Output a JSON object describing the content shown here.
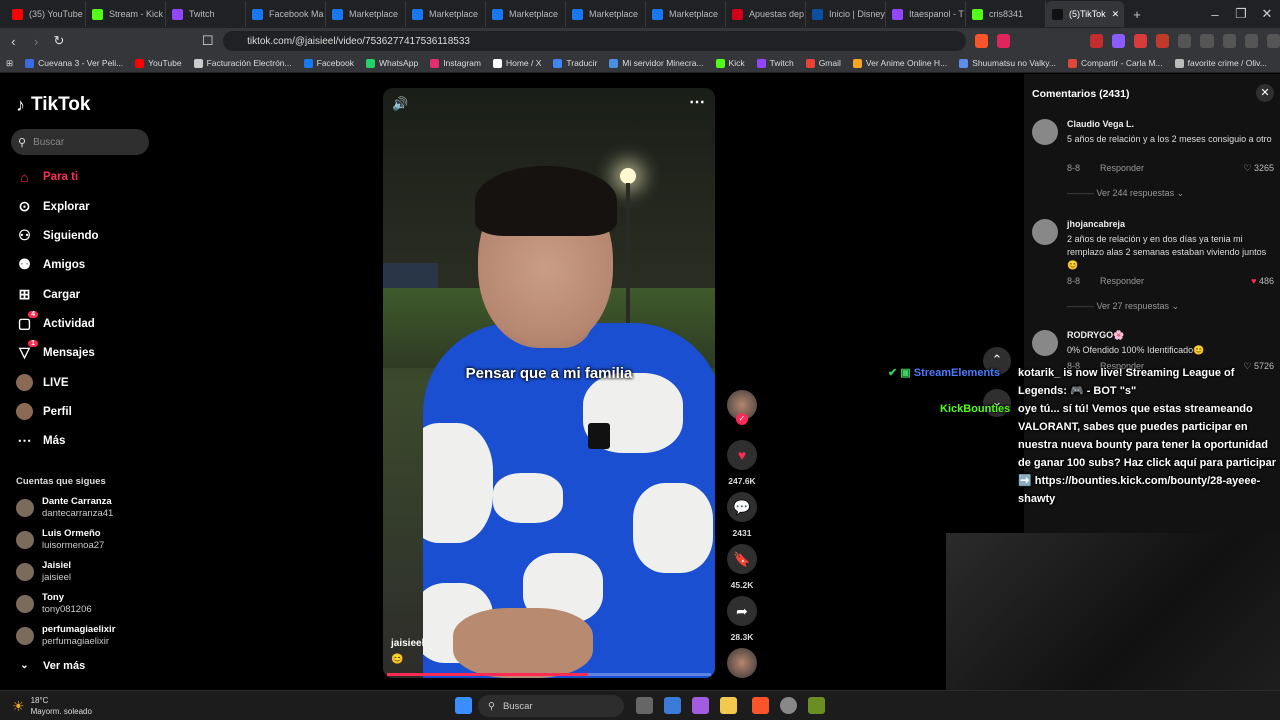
{
  "browser": {
    "tabs": [
      {
        "label": "(35) YouTube",
        "color": "#ff0000"
      },
      {
        "label": "Stream - Kick",
        "color": "#53fc18"
      },
      {
        "label": "Twitch",
        "color": "#9146ff"
      },
      {
        "label": "Facebook Ma",
        "color": "#1877f2"
      },
      {
        "label": "Marketplace",
        "color": "#1877f2"
      },
      {
        "label": "Marketplace",
        "color": "#1877f2"
      },
      {
        "label": "Marketplace",
        "color": "#1877f2"
      },
      {
        "label": "Marketplace",
        "color": "#1877f2"
      },
      {
        "label": "Marketplace",
        "color": "#1877f2"
      },
      {
        "label": "Apuestas dep",
        "color": "#d4001a"
      },
      {
        "label": "Inicio | Disney",
        "color": "#0b4ea2"
      },
      {
        "label": "Itaespanol - T",
        "color": "#9146ff"
      },
      {
        "label": "cris8341",
        "color": "#53fc18"
      },
      {
        "label": "(5)TikTok",
        "color": "#111111",
        "active": true
      }
    ],
    "url": "tiktok.com/@jaisieel/video/7536277417536118533",
    "bookmarks": [
      {
        "label": "Cuevana 3 - Ver Peli...",
        "color": "#3a6be0"
      },
      {
        "label": "YouTube",
        "color": "#ff0000"
      },
      {
        "label": "Facturación Electrón...",
        "color": "#cccccc"
      },
      {
        "label": "Facebook",
        "color": "#1877f2"
      },
      {
        "label": "WhatsApp",
        "color": "#25d366"
      },
      {
        "label": "Instagram",
        "color": "#e1306c"
      },
      {
        "label": "Home / X",
        "color": "#ffffff"
      },
      {
        "label": "Traducir",
        "color": "#4285f4"
      },
      {
        "label": "Mi servidor Minecra...",
        "color": "#4a90e2"
      },
      {
        "label": "Kick",
        "color": "#53fc18"
      },
      {
        "label": "Twitch",
        "color": "#9146ff"
      },
      {
        "label": "Gmail",
        "color": "#ea4335"
      },
      {
        "label": "Ver Anime Online H...",
        "color": "#f5a623"
      },
      {
        "label": "Shuumatsu no Valky...",
        "color": "#5b8def"
      },
      {
        "label": "Compartir - Carla M...",
        "color": "#e0463a"
      },
      {
        "label": "favorite crime / Oliv...",
        "color": "#bbbbbb"
      }
    ]
  },
  "sidebar": {
    "logo": "TikTok",
    "search_placeholder": "Buscar",
    "nav": [
      {
        "label": "Para ti",
        "active": true
      },
      {
        "label": "Explorar"
      },
      {
        "label": "Siguiendo"
      },
      {
        "label": "Amigos"
      },
      {
        "label": "Cargar"
      },
      {
        "label": "Actividad",
        "badge": "4"
      },
      {
        "label": "Mensajes",
        "badge": "1"
      },
      {
        "label": "LIVE"
      },
      {
        "label": "Perfil"
      },
      {
        "label": "Más"
      }
    ],
    "following_title": "Cuentas que sigues",
    "following": [
      {
        "name": "Dante Carranza",
        "handle": "dantecarranza41"
      },
      {
        "name": "Luis Ormeño",
        "handle": "luisormenoa27"
      },
      {
        "name": "Jaisiel",
        "handle": "jaisieel"
      },
      {
        "name": "Tony",
        "handle": "tony081206"
      },
      {
        "name": "perfumagiaelixir",
        "handle": "perfumagiaelixir"
      }
    ],
    "see_more": "Ver más"
  },
  "video": {
    "caption": "Pensar que a mi familia",
    "username": "jaisieel",
    "emoji": "😊",
    "progress": 0.62,
    "likes": "247.6K",
    "comments": "2431",
    "saves": "45.2K",
    "shares": "28.3K"
  },
  "comments_panel": {
    "title": "Comentarios (2431)",
    "comments": [
      {
        "user": "Claudio Vega L.",
        "text": "5 años de relación y a los 2 meses consiguio a otro",
        "date": "8-8",
        "reply": "Responder",
        "likes": "3265",
        "replies": "Ver 244 respuestas"
      },
      {
        "user": "jhojancabreja",
        "text": "2 años de relación y en dos días ya tenia mi remplazo alas 2 semanas estaban viviendo juntos😊",
        "date": "8-8",
        "reply": "Responder",
        "likes": "486",
        "replies": "Ver 27 respuestas",
        "liked": true
      },
      {
        "user": "RODRYGO🌸",
        "text": "0% Ofendido 100% Identificado😊",
        "date": "8-8",
        "reply": "Responder",
        "likes": "5726"
      }
    ]
  },
  "overlay": {
    "se_name": "StreamElements",
    "se_message": "kotarik_ is now live! Streaming League of Legends: 🎮 - BOT \"s\"",
    "kb_name": "KickBounties",
    "kb_message": "oye tú... sí tú! Vemos que estas streameando VALORANT, sabes que puedes participar en nuestra nueva bounty para tener la oportunidad de ganar 100 subs? Haz click aquí para participar",
    "kb_link": "➡️ https://bounties.kick.com/bounty/28-ayeee-shawty"
  },
  "taskbar": {
    "temp": "18°C",
    "weather": "Mayorm. soleado",
    "search": "Buscar"
  }
}
